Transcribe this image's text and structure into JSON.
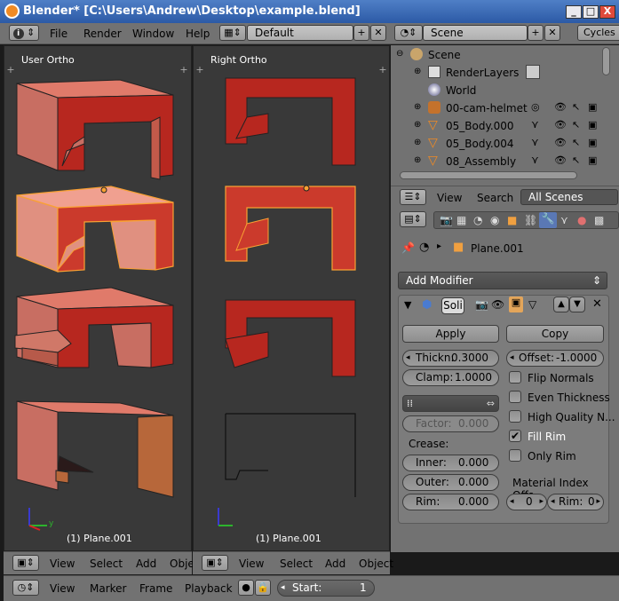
{
  "window": {
    "title": "Blender* [C:\\Users\\Andrew\\Desktop\\example.blend]",
    "min": "_",
    "max": "□",
    "close": "X"
  },
  "mainbar": {
    "info_icon": "i",
    "menus": [
      "File",
      "Render",
      "Window",
      "Help"
    ],
    "screen_layout": "Default",
    "scene": "Scene",
    "engine": "Cycles"
  },
  "viewports": [
    {
      "label": "User Ortho",
      "object_label": "(1) Plane.001",
      "footer": [
        "View",
        "Select",
        "Add",
        "Obje"
      ]
    },
    {
      "label": "Right Ortho",
      "object_label": "(1) Plane.001",
      "footer": [
        "View",
        "Select",
        "Add",
        "Object"
      ]
    }
  ],
  "outliner": {
    "items": [
      {
        "label": "Scene"
      },
      {
        "label": "RenderLayers"
      },
      {
        "label": "World"
      },
      {
        "label": "00-cam-helmet"
      },
      {
        "label": "05_Body.000"
      },
      {
        "label": "05_Body.004"
      },
      {
        "label": "08_Assembly"
      }
    ],
    "header": {
      "view": "View",
      "search": "Search",
      "filter": "All Scenes"
    }
  },
  "properties": {
    "breadcrumb_object": "Plane.001",
    "add_modifier": "Add Modifier",
    "modifier_name": "Soli",
    "apply": "Apply",
    "copy": "Copy",
    "thickness_label": "Thickn:",
    "thickness_value": "0.3000",
    "offset_label": "Offset:",
    "offset_value": "-1.0000",
    "clamp_label": "Clamp:",
    "clamp_value": "1.0000",
    "factor_label": "Factor:",
    "factor_value": "0.000",
    "crease_label": "Crease:",
    "inner_label": "Inner:",
    "inner_value": "0.000",
    "outer_label": "Outer:",
    "outer_value": "0.000",
    "rim_label": "Rim:",
    "rim_value": "0.000",
    "checkboxes": [
      {
        "label": "Flip Normals",
        "checked": false
      },
      {
        "label": "Even Thickness",
        "checked": false
      },
      {
        "label": "High Quality N...",
        "checked": false
      },
      {
        "label": "Fill Rim",
        "checked": true
      },
      {
        "label": "Only Rim",
        "checked": false
      }
    ],
    "material_index_label": "Material Index Offs...",
    "mat_index_value": "0",
    "mat_rim_label": "Rim:",
    "mat_rim_value": "0"
  },
  "timeline": {
    "menus": [
      "View",
      "Marker",
      "Frame",
      "Playback"
    ],
    "start_label": "Start:",
    "start_value": "1"
  }
}
